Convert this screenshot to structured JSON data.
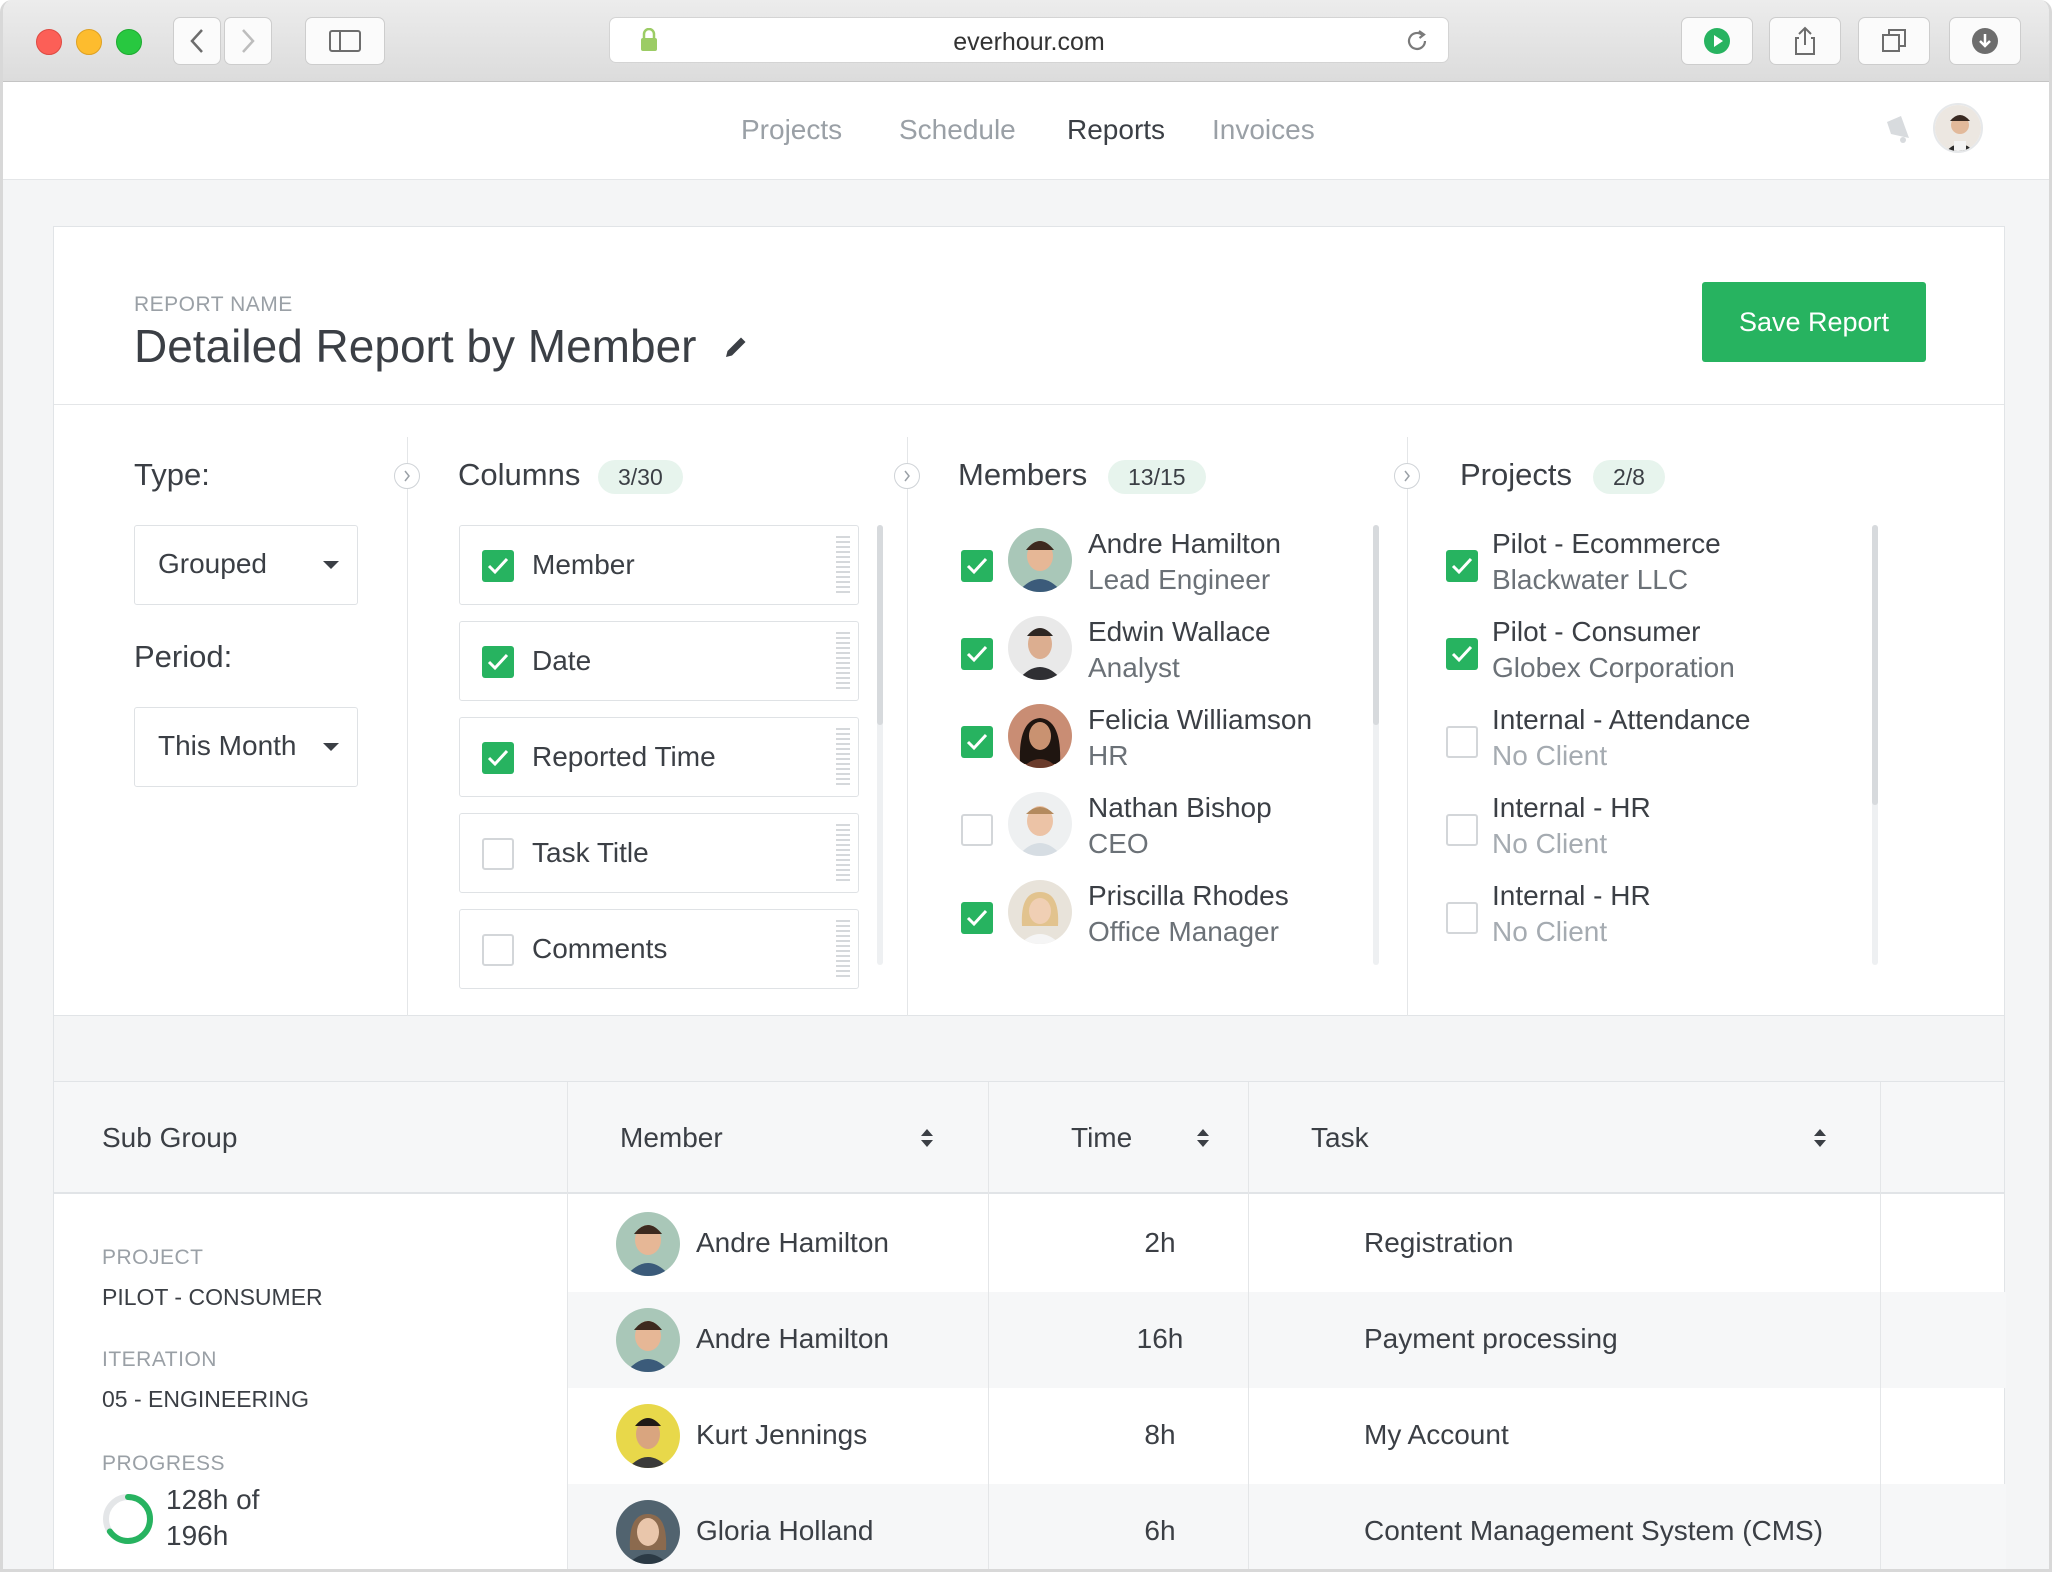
{
  "browser": {
    "url": "everhour.com"
  },
  "nav": {
    "items": [
      "Projects",
      "Schedule",
      "Reports",
      "Invoices"
    ],
    "active": "Reports"
  },
  "report": {
    "name_label": "REPORT NAME",
    "title": "Detailed Report by Member",
    "save_label": "Save Report"
  },
  "filters": {
    "type_label": "Type:",
    "type_value": "Grouped",
    "period_label": "Period:",
    "period_value": "This Month"
  },
  "columns": {
    "title": "Columns",
    "count": "3/30",
    "items": [
      {
        "label": "Member",
        "checked": true
      },
      {
        "label": "Date",
        "checked": true
      },
      {
        "label": "Reported Time",
        "checked": true
      },
      {
        "label": "Task Title",
        "checked": false
      },
      {
        "label": "Comments",
        "checked": false
      }
    ]
  },
  "members": {
    "title": "Members",
    "count": "13/15",
    "items": [
      {
        "name": "Andre Hamilton",
        "role": "Lead Engineer",
        "checked": true
      },
      {
        "name": "Edwin Wallace",
        "role": "Analyst",
        "checked": true
      },
      {
        "name": "Felicia Williamson",
        "role": "HR",
        "checked": true
      },
      {
        "name": "Nathan Bishop",
        "role": "CEO",
        "checked": false
      },
      {
        "name": "Priscilla Rhodes",
        "role": "Office Manager",
        "checked": true
      }
    ]
  },
  "projects": {
    "title": "Projects",
    "count": "2/8",
    "items": [
      {
        "name": "Pilot - Ecommerce",
        "client": "Blackwater LLC",
        "checked": true
      },
      {
        "name": "Pilot - Consumer",
        "client": "Globex Corporation",
        "checked": true
      },
      {
        "name": "Internal - Attendance",
        "client": "No Client",
        "checked": false
      },
      {
        "name": "Internal - HR",
        "client": "No Client",
        "checked": false
      },
      {
        "name": "Internal - HR",
        "client": "No Client",
        "checked": false
      }
    ]
  },
  "table": {
    "headers": {
      "subgroup": "Sub Group",
      "member": "Member",
      "time": "Time",
      "task": "Task"
    },
    "subgroup": {
      "project_label": "PROJECT",
      "project_value": "PILOT - CONSUMER",
      "iteration_label": "ITERATION",
      "iteration_value": "05 - ENGINEERING",
      "progress_label": "PROGRESS",
      "progress_line1": "128h of",
      "progress_line2": "196h",
      "progress_fraction": 0.653
    },
    "rows": [
      {
        "member": "Andre Hamilton",
        "time": "2h",
        "task": "Registration"
      },
      {
        "member": "Andre Hamilton",
        "time": "16h",
        "task": "Payment processing"
      },
      {
        "member": "Kurt Jennings",
        "time": "8h",
        "task": "My Account"
      },
      {
        "member": "Gloria Holland",
        "time": "6h",
        "task": "Content Management System (CMS)"
      }
    ]
  },
  "colors": {
    "accent": "#27b360",
    "text": "#3b3f45",
    "muted": "#9aa0a6"
  },
  "icons": [
    "lock-icon",
    "reload-icon",
    "play-icon",
    "share-icon",
    "tabs-icon",
    "download-icon",
    "sidebar-icon",
    "notification-icon",
    "pencil-icon",
    "chevron-right-icon",
    "caret-down-icon",
    "checkbox-icon",
    "sort-icon"
  ]
}
